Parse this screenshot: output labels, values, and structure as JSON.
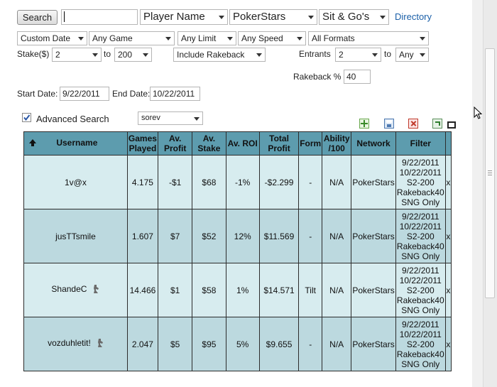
{
  "search_bar": {
    "search_button": "Search",
    "search_value": "",
    "search_type": "Player Name",
    "network": "PokerStars",
    "game_type": "Sit & Go's",
    "directory_link": "Directory"
  },
  "filters": {
    "date_range": "Custom Date",
    "game": "Any Game",
    "limit": "Any Limit",
    "speed": "Any Speed",
    "format": "All Formats",
    "stake_label": "Stake($)",
    "stake_min": "2",
    "stake_to": "to",
    "stake_max": "200",
    "rakeback_option": "Include Rakeback",
    "entrants_label": "Entrants",
    "entrants_min": "2",
    "entrants_to": "to",
    "entrants_max": "Any",
    "rakeback_label": "Rakeback %",
    "rakeback_value": "40",
    "start_date_label": "Start Date:",
    "start_date": "9/22/2011",
    "end_date_label": "End Date:",
    "end_date": "10/22/2011"
  },
  "advanced": {
    "checked": true,
    "label": "Advanced Search",
    "sort_value": "sorev"
  },
  "table": {
    "headers": {
      "username": "Username",
      "games_played": "Games Played",
      "av_profit": "Av. Profit",
      "av_stake": "Av. Stake",
      "av_roi": "Av. ROI",
      "total_profit": "Total Profit",
      "form": "Form",
      "ability": "Ability /100",
      "network": "Network",
      "filter": "Filter"
    },
    "rows": [
      {
        "username": "1v@x",
        "games": "4.175",
        "av_profit": "-$1",
        "av_stake": "$68",
        "av_roi": "-1%",
        "total_profit": "-$2.299",
        "form": "-",
        "ability": "N/A",
        "network": "PokerStars",
        "filter": [
          "9/22/2011",
          "10/22/2011",
          "S2-200",
          "Rakeback40",
          "SNG Only"
        ],
        "remove": "x"
      },
      {
        "username": "jusTTsmile",
        "games": "1.607",
        "av_profit": "$7",
        "av_stake": "$52",
        "av_roi": "12%",
        "total_profit": "$11.569",
        "form": "-",
        "ability": "N/A",
        "network": "PokerStars",
        "filter": [
          "9/22/2011",
          "10/22/2011",
          "S2-200",
          "Rakeback40",
          "SNG Only"
        ],
        "remove": "x"
      },
      {
        "username": "ShandeC",
        "games": "14.466",
        "av_profit": "$1",
        "av_stake": "$58",
        "av_roi": "1%",
        "total_profit": "$14.571",
        "form": "Tilt",
        "ability": "N/A",
        "network": "PokerStars",
        "filter": [
          "9/22/2011",
          "10/22/2011",
          "S2-200",
          "Rakeback40",
          "SNG Only"
        ],
        "remove": "x"
      },
      {
        "username": "vozduhletit!",
        "games": "2.047",
        "av_profit": "$5",
        "av_stake": "$95",
        "av_roi": "5%",
        "total_profit": "$9.655",
        "form": "-",
        "ability": "N/A",
        "network": "PokerStars",
        "filter": [
          "9/22/2011",
          "10/22/2011",
          "S2-200",
          "Rakeback40",
          "SNG Only"
        ],
        "remove": "x"
      }
    ]
  }
}
